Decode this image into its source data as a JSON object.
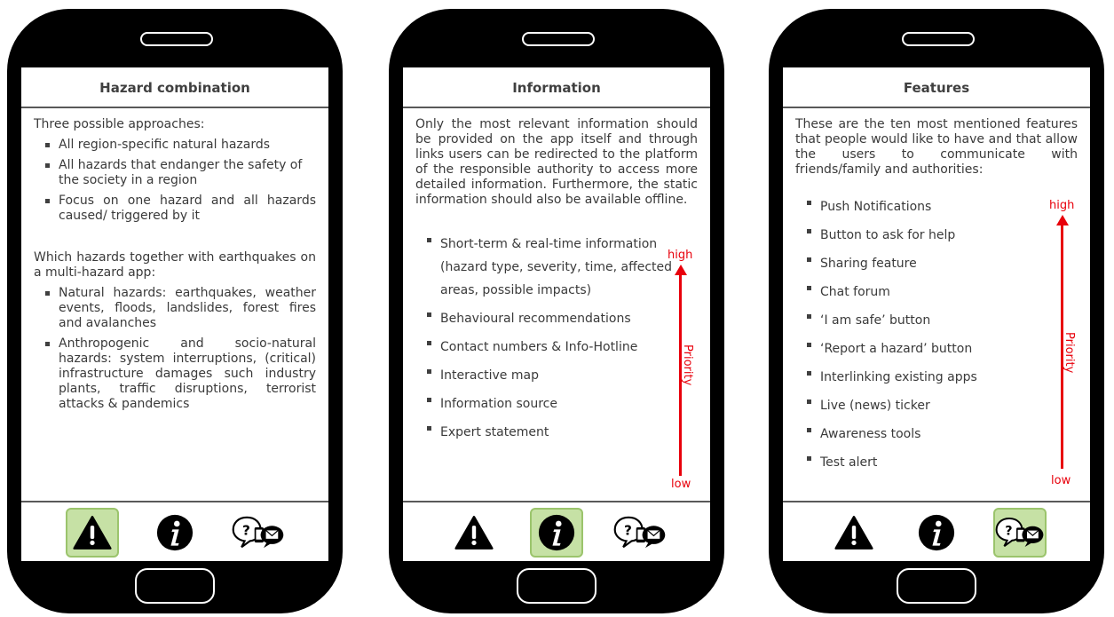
{
  "colors": {
    "accent_red": "#e8000b",
    "active_tab": "#c6e1a5",
    "phone_body": "#000000"
  },
  "phone1": {
    "title": "Hazard combination",
    "intro": "Three possible approaches:",
    "approaches": [
      "All region-specific natural hazards",
      "All hazards that endanger the safety of the society in a region",
      "Focus on one hazard and all hazards caused/ triggered by it"
    ],
    "question": "Which hazards together with earthquakes on a multi-hazard app:",
    "answers": [
      "Natural hazards: earthquakes, weather events, floods, landslides, forest fires and avalanches",
      "Anthropogenic and socio-natural hazards: system interruptions, (critical) infrastructure damages such industry plants, traffic disruptions, terrorist attacks & pandemics"
    ]
  },
  "phone2": {
    "title": "Information",
    "intro": "Only the most relevant information should be provided on the app itself and through links users can be redirected to the platform of the responsible authority to access more detailed information. Furthermore, the static information should also be available offline.",
    "items": [
      "Short-term & real-time information (hazard type, severity, time, affected areas, possible impacts)",
      "Behavioural recommendations",
      "Contact numbers & Info-Hotline",
      "Interactive map",
      "Information source",
      "Expert statement"
    ],
    "priority": {
      "high": "high",
      "low": "low",
      "label": "Priority"
    }
  },
  "phone3": {
    "title": "Features",
    "intro": "These are the ten most mentioned features that people would like to have and that allow the users to communicate with friends/family and authorities:",
    "items": [
      "Push Notifications",
      "Button to ask for help",
      "Sharing feature",
      "Chat forum",
      "‘I am safe’ button",
      "‘Report a hazard’ button",
      "Interlinking existing apps",
      "Live (news) ticker",
      "Awareness tools",
      "Test alert"
    ],
    "priority": {
      "high": "high",
      "low": "low",
      "label": "Priority"
    }
  },
  "nav": {
    "icons": [
      "warning-icon",
      "info-icon",
      "chat-icon"
    ],
    "active": [
      "warning-icon",
      "info-icon",
      "chat-icon"
    ]
  }
}
